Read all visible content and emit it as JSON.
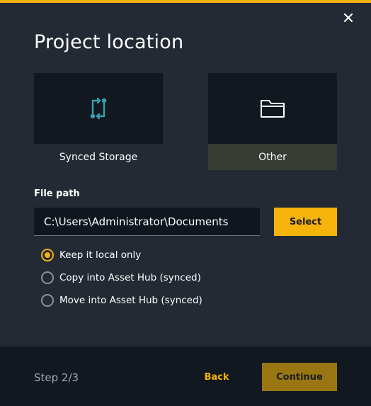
{
  "dialog": {
    "title": "Project location",
    "close_icon": "close-icon",
    "accent_color": "#f5b30c"
  },
  "cards": [
    {
      "label": "Synced Storage",
      "icon": "sync-arrows-icon",
      "selected": false
    },
    {
      "label": "Other",
      "icon": "folder-icon",
      "selected": true
    }
  ],
  "file_path": {
    "label": "File path",
    "value": "C:\\Users\\Administrator\\Documents",
    "select_label": "Select"
  },
  "options": [
    {
      "label": "Keep it local only",
      "checked": true
    },
    {
      "label": "Copy into Asset Hub (synced)",
      "checked": false
    },
    {
      "label": "Move into Asset Hub (synced)",
      "checked": false
    }
  ],
  "footer": {
    "step": "Step 2/3",
    "back_label": "Back",
    "continue_label": "Continue"
  }
}
